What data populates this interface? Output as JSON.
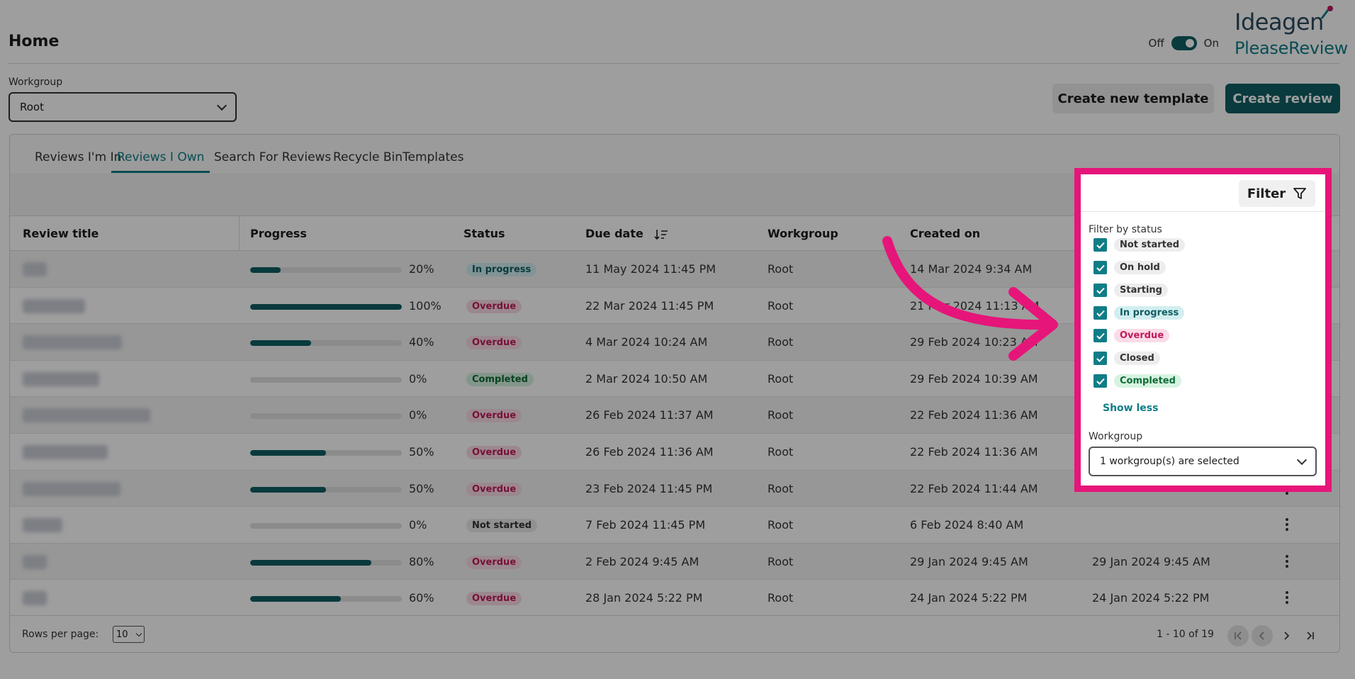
{
  "header": {
    "title": "Home",
    "toggle_off": "Off",
    "toggle_on": "On",
    "logo_top": "Ideagen",
    "logo_bottom": "PleaseReview"
  },
  "workgroup": {
    "label": "Workgroup",
    "value": "Root"
  },
  "actions": {
    "create_template": "Create new template",
    "create_review": "Create review"
  },
  "tabs": [
    {
      "label": "Reviews I'm In"
    },
    {
      "label": "Reviews I Own"
    },
    {
      "label": "Search For Reviews"
    },
    {
      "label": "Recycle Bin"
    },
    {
      "label": "Templates"
    }
  ],
  "active_tab": "Reviews I Own",
  "table": {
    "columns": [
      "Review title",
      "Progress",
      "Status",
      "Due date",
      "Workgroup",
      "Created on"
    ],
    "rows": [
      {
        "progress": 0.2,
        "pct": "20%",
        "status": "In progress",
        "status_type": "inprogress",
        "due": "11 May 2024 11:45 PM",
        "workgroup": "Root",
        "created": "14 Mar 2024 9:34 AM",
        "modified": ""
      },
      {
        "progress": 1.0,
        "pct": "100%",
        "status": "Overdue",
        "status_type": "overdue",
        "due": "22 Mar 2024 11:45 PM",
        "workgroup": "Root",
        "created": "21 Mar 2024 11:13 AM",
        "modified": ""
      },
      {
        "progress": 0.4,
        "pct": "40%",
        "status": "Overdue",
        "status_type": "overdue",
        "due": "4 Mar 2024 10:24 AM",
        "workgroup": "Root",
        "created": "29 Feb 2024 10:23 AM",
        "modified": ""
      },
      {
        "progress": 0.0,
        "pct": "0%",
        "status": "Completed",
        "status_type": "completed",
        "due": "2 Mar 2024 10:50 AM",
        "workgroup": "Root",
        "created": "29 Feb 2024 10:39 AM",
        "modified": ""
      },
      {
        "progress": 0.0,
        "pct": "0%",
        "status": "Overdue",
        "status_type": "overdue",
        "due": "26 Feb 2024 11:37 AM",
        "workgroup": "Root",
        "created": "22 Feb 2024 11:36 AM",
        "modified": ""
      },
      {
        "progress": 0.5,
        "pct": "50%",
        "status": "Overdue",
        "status_type": "overdue",
        "due": "26 Feb 2024 11:36 AM",
        "workgroup": "Root",
        "created": "22 Feb 2024 11:36 AM",
        "modified": ""
      },
      {
        "progress": 0.5,
        "pct": "50%",
        "status": "Overdue",
        "status_type": "overdue",
        "due": "23 Feb 2024 11:45 PM",
        "workgroup": "Root",
        "created": "22 Feb 2024 11:44 AM",
        "modified": ""
      },
      {
        "progress": 0.0,
        "pct": "0%",
        "status": "Not started",
        "status_type": "notstarted",
        "due": "7 Feb 2024 11:45 PM",
        "workgroup": "Root",
        "created": "6 Feb 2024 8:40 AM",
        "modified": ""
      },
      {
        "progress": 0.8,
        "pct": "80%",
        "status": "Overdue",
        "status_type": "overdue",
        "due": "2 Feb 2024 9:45 AM",
        "workgroup": "Root",
        "created": "29 Jan 2024 9:45 AM",
        "modified": "29 Jan 2024 9:45 AM"
      },
      {
        "progress": 0.6,
        "pct": "60%",
        "status": "Overdue",
        "status_type": "overdue",
        "due": "28 Jan 2024 5:22 PM",
        "workgroup": "Root",
        "created": "24 Jan 2024 5:22 PM",
        "modified": "24 Jan 2024 5:22 PM"
      }
    ]
  },
  "pagination": {
    "rows_per_page_label": "Rows per page:",
    "rows_per_page": "10",
    "info": "1 - 10 of 19"
  },
  "filter": {
    "button_label": "Filter",
    "by_status_label": "Filter by status",
    "statuses": [
      {
        "label": "Not started",
        "type": "notstarted",
        "checked": true
      },
      {
        "label": "On hold",
        "type": "onhold",
        "checked": true
      },
      {
        "label": "Starting",
        "type": "starting",
        "checked": true
      },
      {
        "label": "In progress",
        "type": "inprogress",
        "checked": true
      },
      {
        "label": "Overdue",
        "type": "overdue",
        "checked": true
      },
      {
        "label": "Closed",
        "type": "closed",
        "checked": true
      },
      {
        "label": "Completed",
        "type": "completed",
        "checked": true
      }
    ],
    "show_less": "Show less",
    "workgroup_label": "Workgroup",
    "workgroup_value": "1 workgroup(s) are selected"
  },
  "colors": {
    "primary": "#0f5e63",
    "accent": "#0f7d86",
    "highlight": "#e6157a"
  }
}
